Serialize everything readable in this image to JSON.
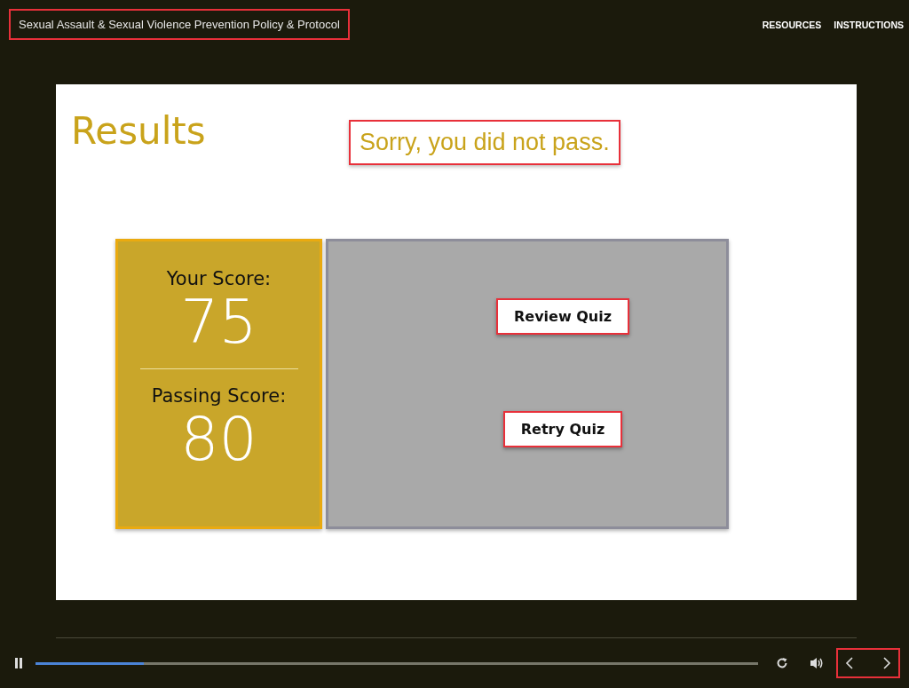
{
  "header": {
    "title": "Sexual Assault & Sexual Violence Prevention Policy & Protocol",
    "title_highlighted": true,
    "links": [
      "RESOURCES",
      "INSTRUCTIONS"
    ]
  },
  "slide": {
    "heading": "Results",
    "message": "Sorry, you did not pass.",
    "message_highlighted": true,
    "scores": [
      {
        "label": "Your Score:",
        "value": "75"
      },
      {
        "label": "Passing Score:",
        "value": "80"
      }
    ],
    "buttons": [
      {
        "label": "Review Quiz",
        "highlighted": true
      },
      {
        "label": "Retry Quiz",
        "highlighted": true
      }
    ]
  },
  "player": {
    "playing": true,
    "progress": {
      "level": 0.15
    },
    "nav_highlighted": true
  }
}
